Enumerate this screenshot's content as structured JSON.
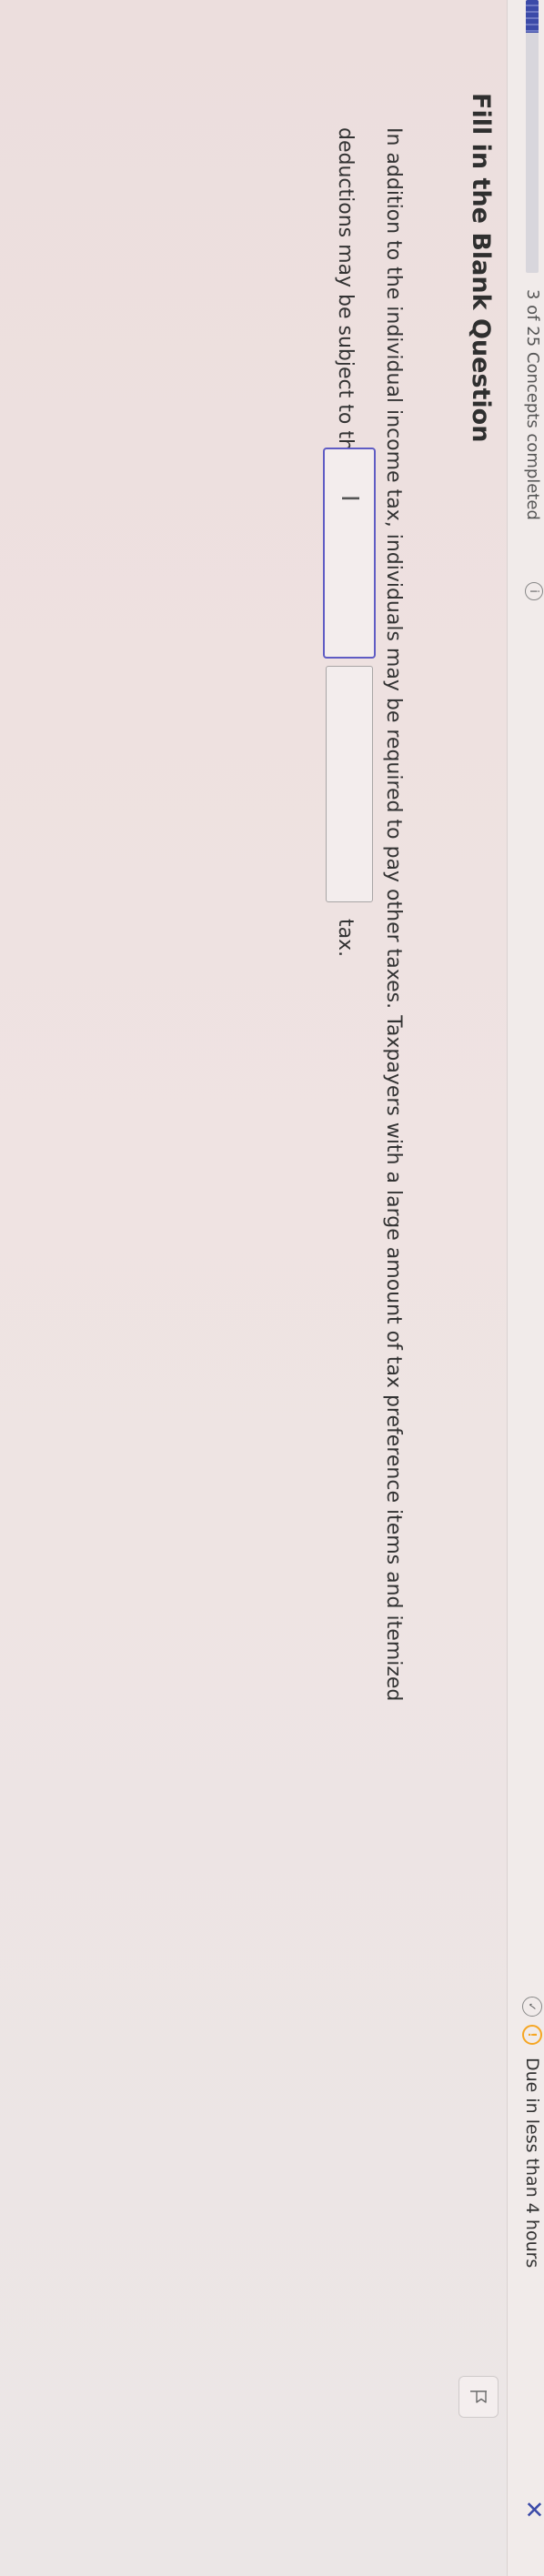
{
  "status_bar": {
    "progress_fraction": 0.12,
    "progress_text": "3 of 25 Concepts completed",
    "info_symbol": "i",
    "check_symbol": "✓",
    "clock_symbol": "!",
    "due_text": "Due in less than 4 hours",
    "close_symbol": "✕",
    "accent_color": "#3b4aa8",
    "warning_color": "#f5a623"
  },
  "question": {
    "title": "Fill in the Blank Question",
    "line1": "In addition to the individual income tax, individuals may be required to pay other taxes. Taxpayers with a large amount of tax preference items and itemized",
    "line2_before": "deductions may be subject to the",
    "blank1_value": "",
    "blank2_value": "",
    "line2_after": "tax.",
    "flag_icon": "flag-icon",
    "cursor_icon": "text-cursor-icon"
  }
}
